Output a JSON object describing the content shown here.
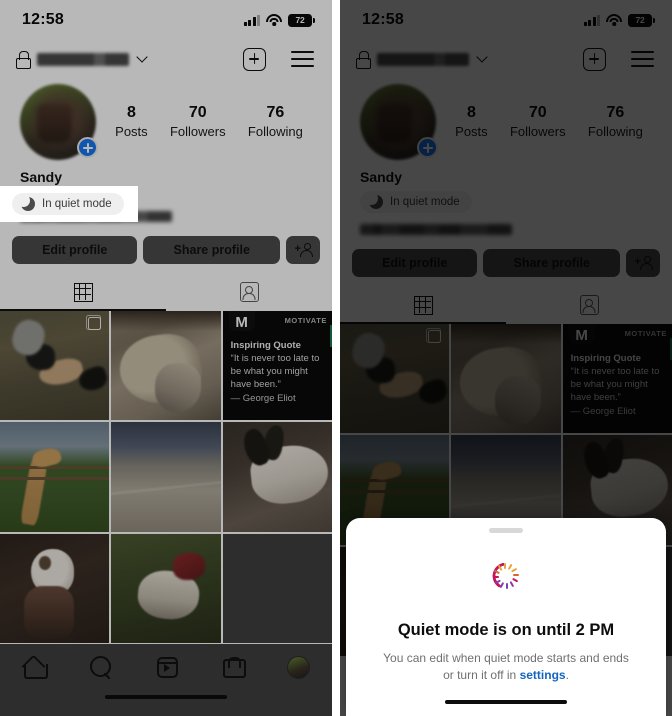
{
  "status_bar": {
    "time": "12:58",
    "battery_level": "72",
    "icons": [
      "cellular-signal-icon",
      "wifi-icon",
      "battery-icon"
    ]
  },
  "header": {
    "lock_icon": "lock-icon",
    "username": "",
    "username_redacted": true,
    "chevron": "chevron-down-icon",
    "new_post_label": "create-new-post",
    "menu_label": "open-menu"
  },
  "profile": {
    "display_name": "Sandy",
    "avatar_badge": "+",
    "stats": [
      {
        "value": "8",
        "label": "Posts"
      },
      {
        "value": "70",
        "label": "Followers"
      },
      {
        "value": "76",
        "label": "Following"
      }
    ],
    "bio_redacted": true
  },
  "quiet_mode_tooltip": {
    "icon": "moon-icon",
    "label": "In quiet mode"
  },
  "actions": {
    "edit_profile": "Edit profile",
    "share_profile": "Share profile",
    "discover_people_icon": "add-person-icon"
  },
  "tabs": [
    {
      "name": "grid-tab",
      "icon": "grid-icon",
      "selected": true
    },
    {
      "name": "tagged-tab",
      "icon": "tagged-person-icon",
      "selected": false
    }
  ],
  "posts": [
    {
      "id": "post-1",
      "alt": "two dogs on dirt ground",
      "multi": true
    },
    {
      "id": "post-2",
      "alt": "dog lying on blanket",
      "multi": false
    },
    {
      "id": "post-3",
      "alt": "motivational quote card",
      "multi": false,
      "brand": "MOTIVATE",
      "logo": "M",
      "title": "Inspiring Quote",
      "text": "“It is never too late to be what you might have been.”",
      "author": "— George Eliot"
    },
    {
      "id": "post-4",
      "alt": "giraffe behind fence",
      "multi": false
    },
    {
      "id": "post-5",
      "alt": "beach shoreline",
      "multi": false
    },
    {
      "id": "post-6",
      "alt": "black and white dog on rock",
      "multi": false
    },
    {
      "id": "post-7",
      "alt": "dog on couch",
      "multi": false
    },
    {
      "id": "post-8",
      "alt": "dog sleeping on green blanket",
      "multi": false
    }
  ],
  "bottom_nav": [
    {
      "name": "nav-home",
      "icon": "home-icon"
    },
    {
      "name": "nav-search",
      "icon": "search-icon"
    },
    {
      "name": "nav-reels",
      "icon": "reels-icon"
    },
    {
      "name": "nav-shop",
      "icon": "shop-bag-icon"
    },
    {
      "name": "nav-profile",
      "icon": "profile-avatar-icon"
    }
  ],
  "quiet_sheet": {
    "grabber": "drag-handle",
    "icon": "moon-with-rays-icon",
    "title": "Quiet mode is on until 2 PM",
    "description_before": "You can edit when quiet mode starts and ends or turn it off in ",
    "link": "settings",
    "description_after": "."
  },
  "colors": {
    "link": "#1565c0",
    "badge_blue": "#1877f2",
    "moon_crimson": "#c2185b",
    "ray_orange": "#e8a33d",
    "ray_purple": "#7b3fb5",
    "quote_accent": "#1b7a4f"
  }
}
